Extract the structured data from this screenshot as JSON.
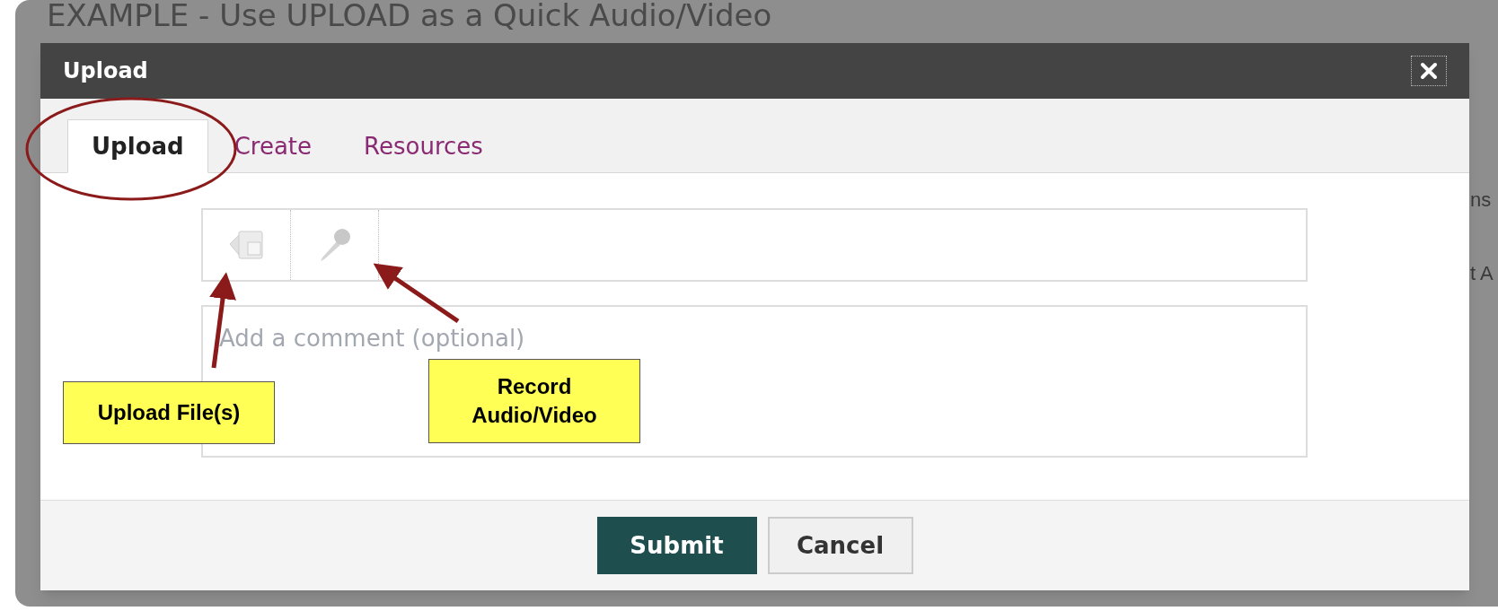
{
  "background_page": {
    "title": "EXAMPLE - Use UPLOAD as a Quick Audio/Video",
    "fragments": [
      "ns",
      "t A"
    ]
  },
  "dialog": {
    "title": "Upload",
    "tabs": [
      {
        "label": "Upload",
        "selected": true
      },
      {
        "label": "Create",
        "selected": false
      },
      {
        "label": "Resources",
        "selected": false
      }
    ],
    "tools": [
      {
        "kind": "upload"
      },
      {
        "kind": "record"
      }
    ],
    "comment": {
      "placeholder": "Add a comment (optional)"
    },
    "buttons": [
      {
        "label": "Submit",
        "kind": "primary"
      },
      {
        "label": "Cancel",
        "kind": "secondary"
      }
    ]
  },
  "callouts": [
    {
      "text": "Upload File(s)"
    },
    {
      "text": "Record Audio/Video"
    }
  ]
}
